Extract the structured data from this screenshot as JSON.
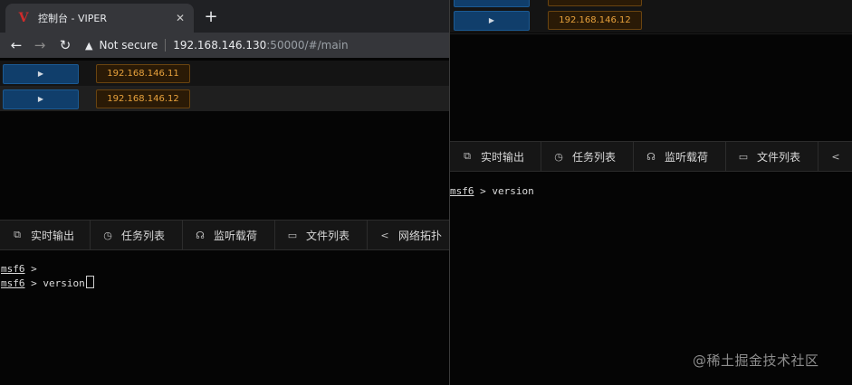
{
  "browser": {
    "tab_title": "控制台 - VIPER",
    "favicon_text": "V",
    "close_glyph": "✕",
    "newtab_glyph": "+",
    "security_label": "Not secure",
    "url_host": "192.168.146.130",
    "url_path": ":50000/#/main",
    "icons": [
      "back-arrow-icon",
      "forward-arrow-icon",
      "reload-icon",
      "warning-icon"
    ]
  },
  "left_pane": {
    "hosts": [
      {
        "expand": "▶",
        "ip": "192.168.146.11"
      },
      {
        "expand": "▶",
        "ip": "192.168.146.12"
      }
    ],
    "tabs": [
      {
        "icon": "⧉",
        "icon_name": "monitor-icon",
        "label": "实时输出"
      },
      {
        "icon": "◷",
        "icon_name": "clock-icon",
        "label": "任务列表"
      },
      {
        "icon": "☊",
        "icon_name": "headphones-icon",
        "label": "监听载荷"
      },
      {
        "icon": "▭",
        "icon_name": "folder-icon",
        "label": "文件列表"
      },
      {
        "icon": "<",
        "icon_name": "share-icon",
        "label": "网络拓扑"
      }
    ],
    "terminal": {
      "prompt": "msf6",
      "separator": " >",
      "line2_separator": " > ",
      "command": "version"
    }
  },
  "right_pane": {
    "hosts": [
      {
        "expand": "▶",
        "ip": "192.168.146.12"
      }
    ],
    "tabs": [
      {
        "icon": "⧉",
        "icon_name": "monitor-icon",
        "label": "实时输出"
      },
      {
        "icon": "◷",
        "icon_name": "clock-icon",
        "label": "任务列表"
      },
      {
        "icon": "☊",
        "icon_name": "headphones-icon",
        "label": "监听载荷"
      },
      {
        "icon": "▭",
        "icon_name": "folder-icon",
        "label": "文件列表"
      },
      {
        "icon": "<",
        "icon_name": "share-icon",
        "label": ""
      }
    ],
    "terminal": {
      "prompt": "msf6",
      "separator": " > ",
      "command": "version"
    }
  },
  "watermark": "@稀土掘金技术社区",
  "colors": {
    "accent_ip": "#e8a23c",
    "expand_button": "#103e6b",
    "background": "#050505"
  }
}
